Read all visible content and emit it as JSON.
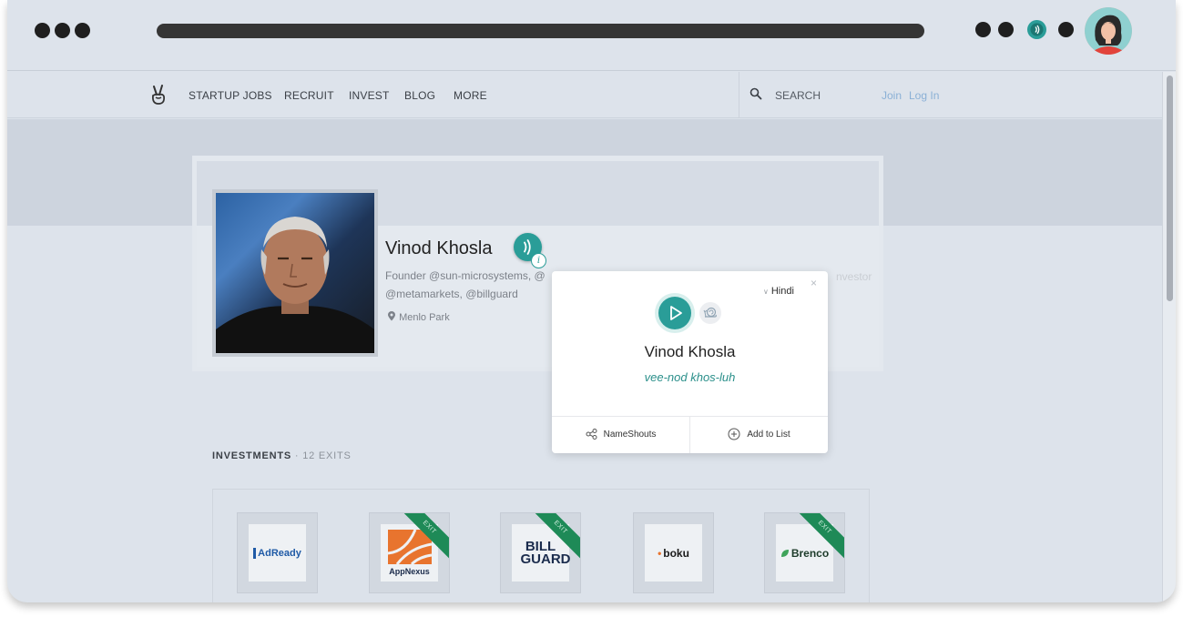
{
  "nav": {
    "items": [
      "STARTUP JOBS",
      "RECRUIT",
      "INVEST",
      "BLOG",
      "MORE"
    ],
    "search_placeholder": "SEARCH",
    "join": "Join",
    "login": "Log In"
  },
  "profile": {
    "name": "Vinod Khosla",
    "bio_line1": "Founder @sun-microsystems, @",
    "bio_line2": "@metamarkets, @billguard",
    "bio_ghost": "nvestor",
    "location": "Menlo Park"
  },
  "popup": {
    "language": "Hindi",
    "close": "×",
    "name": "Vinod Khosla",
    "phonetic": "vee-nod khos-luh",
    "nameshouts": "NameShouts",
    "add_to_list": "Add to List"
  },
  "investments": {
    "title": "INVESTMENTS",
    "separator": " · ",
    "exits": "12 EXITS",
    "exit_label": "EXIT",
    "companies": [
      {
        "name": "AdReady",
        "exit": false
      },
      {
        "name": "AppNexus",
        "exit": true
      },
      {
        "name": "BILL GUARD",
        "exit": true
      },
      {
        "name": "boku",
        "exit": false
      },
      {
        "name": "Brenco",
        "exit": true
      }
    ]
  },
  "icons": {
    "logo": "victory-hand-icon",
    "search": "search-icon",
    "audio": "audio-wave-icon",
    "info": "info-icon",
    "play": "play-icon",
    "slow": "snail-icon",
    "share": "share-icon",
    "add": "plus-circle-icon",
    "location": "pin-icon"
  },
  "colors": {
    "accent": "#2a9d98",
    "exit_ribbon": "#1e8a57",
    "link": "#8ab0d6",
    "page_bg": "#dde3eb"
  }
}
